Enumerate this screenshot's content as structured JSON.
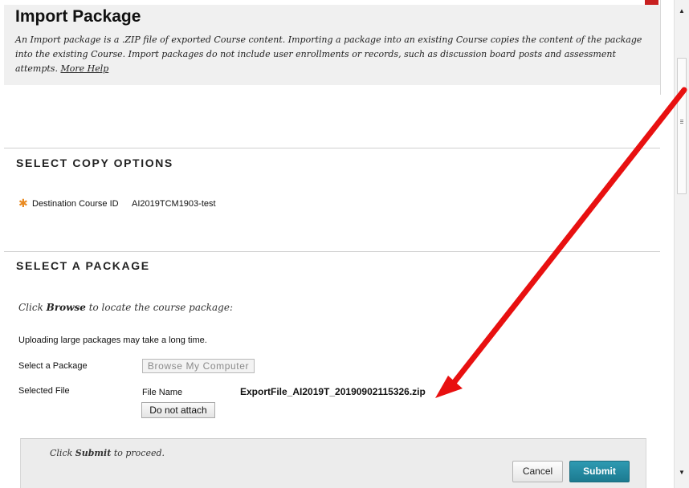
{
  "header": {
    "title": "Import Package",
    "description": "An Import package is a .ZIP file of exported Course content. Importing a package into an existing Course copies the content of the package into the existing Course. Import packages do not include user enrollments or records, such as discussion board posts and assessment attempts.",
    "more_help": "More Help"
  },
  "copy_options": {
    "section_title": "SELECT COPY OPTIONS",
    "required_marker": "✱",
    "destination_label": "Destination Course ID",
    "destination_value": "AI2019TCM1903-test"
  },
  "package": {
    "section_title": "SELECT A PACKAGE",
    "browse_hint_pre": "Click ",
    "browse_hint_bold": "Browse",
    "browse_hint_post": " to locate the course package:",
    "upload_note": "Uploading large packages may take a long time.",
    "select_label": "Select a Package",
    "browse_button": "Browse My Computer",
    "selected_label": "Selected File",
    "file_name_label": "File Name",
    "file_name_value": "ExportFile_AI2019T_20190902115326.zip",
    "detach_button": "Do not attach"
  },
  "submit_panel": {
    "hint_pre": "Click ",
    "hint_bold": "Submit",
    "hint_post": " to proceed.",
    "cancel_button": "Cancel",
    "submit_button": "Submit"
  },
  "colors": {
    "annotation_arrow": "#e81010",
    "submit_button": "#1f8199",
    "required_star": "#e98a20"
  },
  "icons": {
    "scroll_up": "scroll-up-arrow-icon",
    "scroll_down": "scroll-down-arrow-icon",
    "annotation": "red-arrow-annotation-icon"
  }
}
